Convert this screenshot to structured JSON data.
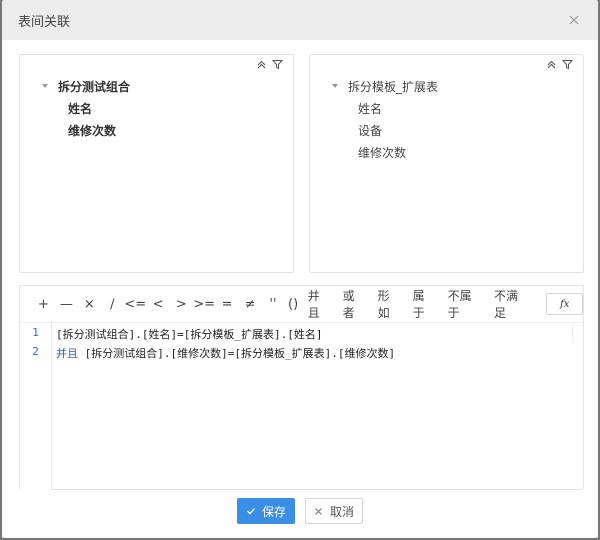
{
  "dialog": {
    "title": "表间关联"
  },
  "left_panel": {
    "root": "拆分测试组合",
    "children": [
      "姓名",
      "维修次数"
    ]
  },
  "right_panel": {
    "root": "拆分模板_扩展表",
    "children": [
      "姓名",
      "设备",
      "维修次数"
    ]
  },
  "operators": {
    "symbols": [
      "+",
      "—",
      "×",
      "∕",
      "<=",
      "<",
      ">",
      ">=",
      "=",
      "≠",
      "''",
      "()"
    ],
    "words": [
      "并且",
      "或者",
      "形如",
      "属于",
      "不属于",
      "不满足"
    ],
    "fx_label": "fx"
  },
  "code": {
    "line_numbers": [
      "1",
      "2"
    ],
    "line1": "[拆分测试组合].[姓名]=[拆分模板_扩展表].[姓名]",
    "line2_keyword": "并且",
    "line2_rest": " [拆分测试组合].[维修次数]=[拆分模板_扩展表].[维修次数]"
  },
  "footer": {
    "save_label": "保存",
    "cancel_label": "取消"
  },
  "colors": {
    "primary": "#3a8ee6",
    "keyword": "#2a57d6"
  }
}
